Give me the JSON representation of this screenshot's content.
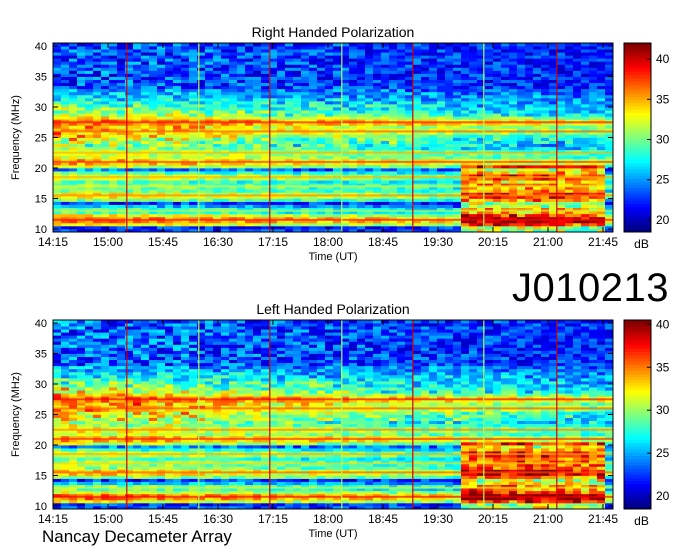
{
  "observation_id": "J010213",
  "credit": "Nancay Decameter Array",
  "chart_data": [
    {
      "type": "heatmap",
      "title": "Right Handed Polarization",
      "xlabel": "Time (UT)",
      "ylabel": "Frequency (MHz)",
      "x_ticks": [
        "14:15",
        "15:00",
        "15:45",
        "16:30",
        "17:15",
        "18:00",
        "18:45",
        "19:30",
        "20:15",
        "21:00",
        "21:45"
      ],
      "y_ticks": [
        10,
        15,
        20,
        25,
        30,
        35,
        40
      ],
      "ylim": [
        9.5,
        40.5
      ],
      "colorbar": {
        "label": "dB",
        "ticks": [
          20,
          25,
          30,
          35,
          40
        ],
        "range": [
          18.5,
          42
        ]
      },
      "spectral_bands_mhz": [
        {
          "f": 27.5,
          "db": 40
        },
        {
          "f": 26.0,
          "db": 38
        },
        {
          "f": 22.5,
          "db": 36
        },
        {
          "f": 21.0,
          "db": 39
        },
        {
          "f": 18.5,
          "db": 36
        },
        {
          "f": 17.0,
          "db": 34
        },
        {
          "f": 15.5,
          "db": 37
        },
        {
          "f": 13.0,
          "db": 33
        },
        {
          "f": 11.5,
          "db": 40
        }
      ],
      "event_start": "19:45",
      "event_end": "21:45",
      "background_db": 20
    },
    {
      "type": "heatmap",
      "title": "Left Handed Polarization",
      "xlabel": "Time (UT)",
      "ylabel": "Frequency (MHz)",
      "x_ticks": [
        "14:15",
        "15:00",
        "15:45",
        "16:30",
        "17:15",
        "18:00",
        "18:45",
        "19:30",
        "20:15",
        "21:00",
        "21:45"
      ],
      "y_ticks": [
        10,
        15,
        20,
        25,
        30,
        35,
        40
      ],
      "ylim": [
        9.5,
        40.5
      ],
      "colorbar": {
        "label": "dB",
        "ticks": [
          20,
          25,
          30,
          35,
          40
        ],
        "range": [
          18.5,
          40.5
        ]
      },
      "spectral_bands_mhz": [
        {
          "f": 27.5,
          "db": 39
        },
        {
          "f": 26.0,
          "db": 37
        },
        {
          "f": 22.5,
          "db": 36
        },
        {
          "f": 21.0,
          "db": 38
        },
        {
          "f": 18.5,
          "db": 35
        },
        {
          "f": 17.0,
          "db": 34
        },
        {
          "f": 15.5,
          "db": 37
        },
        {
          "f": 13.0,
          "db": 33
        },
        {
          "f": 11.5,
          "db": 39
        }
      ],
      "event_start": "19:45",
      "event_end": "21:45",
      "background_db": 20
    }
  ]
}
